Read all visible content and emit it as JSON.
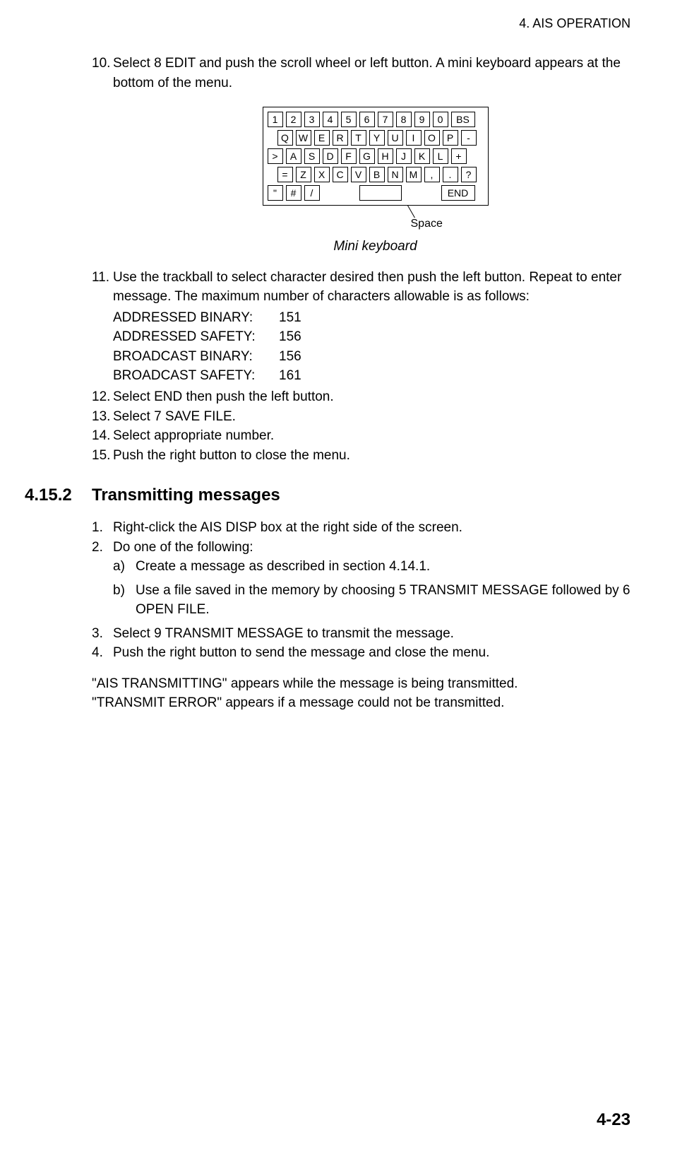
{
  "header": {
    "running": "4. AIS OPERATION"
  },
  "step10": {
    "num": "10.",
    "text": "Select 8 EDIT and push the scroll wheel or left button. A mini keyboard appears at the bottom of the menu."
  },
  "keyboard": {
    "rows": [
      [
        "1",
        "2",
        "3",
        "4",
        "5",
        "6",
        "7",
        "8",
        "9",
        "0",
        "BS"
      ],
      [
        "Q",
        "W",
        "E",
        "R",
        "T",
        "Y",
        "U",
        "I",
        "O",
        "P",
        "-"
      ],
      [
        ">",
        "A",
        "S",
        "D",
        "F",
        "G",
        "H",
        "J",
        "K",
        "L",
        "+"
      ],
      [
        "=",
        "Z",
        "X",
        "C",
        "V",
        "B",
        "N",
        "M",
        ",",
        ".",
        "?"
      ],
      [
        "\"",
        "#",
        "/",
        "SPACE",
        "END"
      ]
    ],
    "callout": "Space",
    "caption": "Mini keyboard"
  },
  "step11": {
    "num": "11.",
    "intro": "Use the trackball to select character desired then push the left button. Repeat to enter message. The maximum number of characters allowable is as follows:",
    "limits": [
      {
        "label": "ADDRESSED BINARY:",
        "value": "151"
      },
      {
        "label": "ADDRESSED SAFETY:",
        "value": "156"
      },
      {
        "label": "BROADCAST BINARY:",
        "value": "156"
      },
      {
        "label": "BROADCAST SAFETY:",
        "value": "161"
      }
    ]
  },
  "step12": {
    "num": "12.",
    "text": "Select END then push the left button."
  },
  "step13": {
    "num": "13.",
    "text": "Select 7 SAVE FILE."
  },
  "step14": {
    "num": "14.",
    "text": "Select appropriate number."
  },
  "step15": {
    "num": "15.",
    "text": "Push the right button to close the menu."
  },
  "section": {
    "num": "4.15.2",
    "title": "Transmitting messages"
  },
  "tx": {
    "s1": {
      "num": "1.",
      "text": "Right-click the AIS DISP box at the right side of the screen."
    },
    "s2": {
      "num": "2.",
      "text": "Do one of the following:"
    },
    "s2a": {
      "num": "a)",
      "text": "Create a message as described in section 4.14.1."
    },
    "s2b": {
      "num": "b)",
      "text": "Use a file saved in the memory by choosing 5 TRANSMIT MESSAGE followed by 6 OPEN FILE."
    },
    "s3": {
      "num": "3.",
      "text": "Select 9 TRANSMIT MESSAGE to transmit the message."
    },
    "s4": {
      "num": "4.",
      "text": "Push the right button to send the message and close the menu."
    }
  },
  "closing": {
    "l1": "\"AIS TRANSMITTING\" appears while the message is being transmitted.",
    "l2": "\"TRANSMIT ERROR\" appears if a message could not be transmitted."
  },
  "pageNumber": "4-23"
}
